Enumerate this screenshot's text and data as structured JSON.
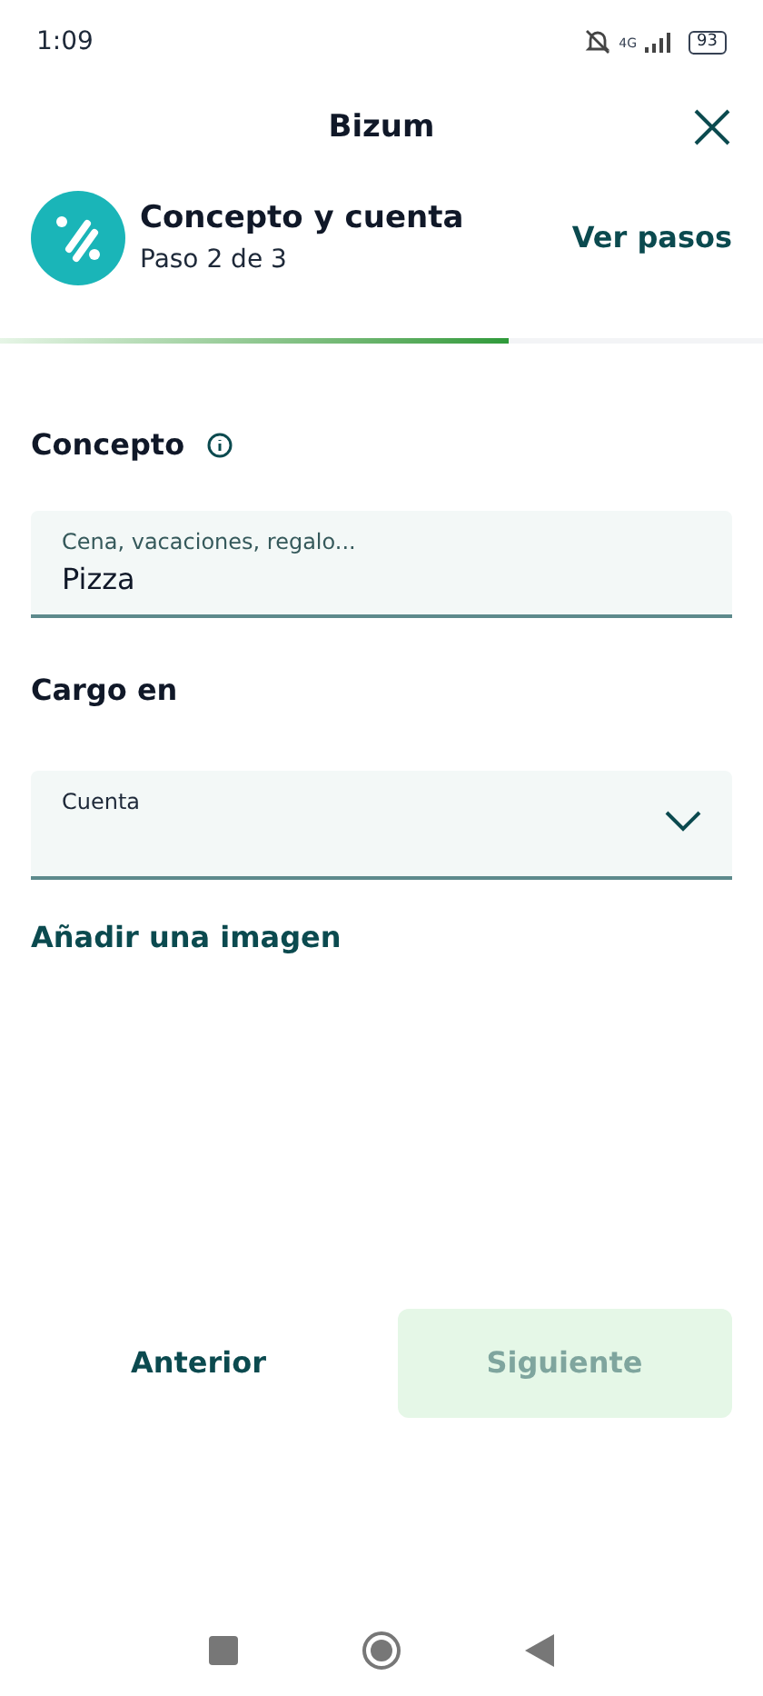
{
  "status_bar": {
    "time": "1:09",
    "network": "4G",
    "battery": "93"
  },
  "header": {
    "title": "Bizum"
  },
  "step": {
    "title": "Concepto y cuenta",
    "subtitle": "Paso 2 de 3",
    "link": "Ver pasos",
    "level": 0.667
  },
  "concept": {
    "label": "Concepto",
    "placeholder": "Cena, vacaciones, regalo...",
    "value": "Pizza"
  },
  "account": {
    "label": "Cargo en",
    "field_label": "Cuenta"
  },
  "add_image": "Añadir una imagen",
  "buttons": [
    {
      "label": "Anterior",
      "kind": "text",
      "disabled": false
    },
    {
      "label": "Siguiente",
      "kind": "filled",
      "disabled": true
    }
  ]
}
